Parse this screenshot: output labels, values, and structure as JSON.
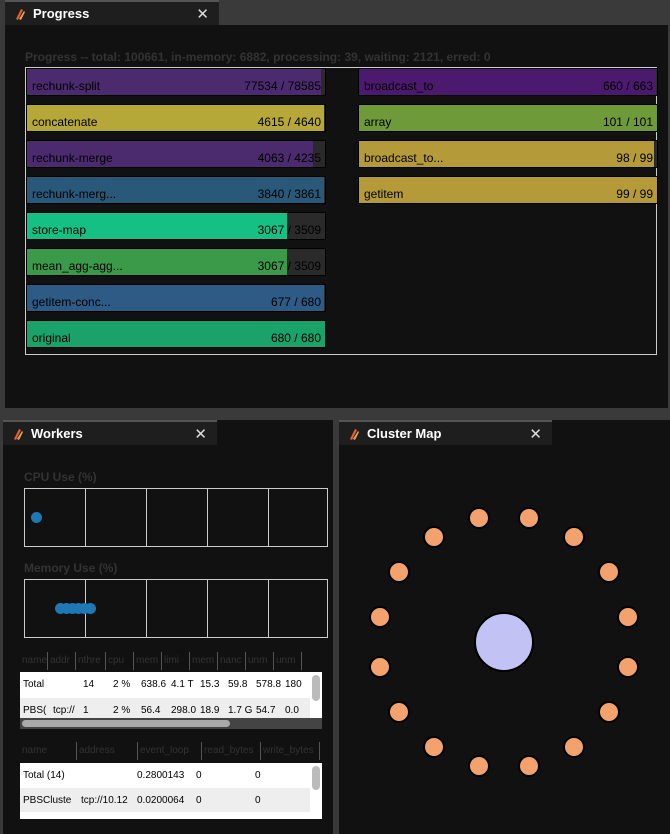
{
  "progress": {
    "tab_title": "Progress",
    "summary": "Progress -- total: 100661, in-memory: 6882, processing: 39, waiting: 2121, erred: 0",
    "left": [
      {
        "name": "rechunk-split",
        "count": "77534 / 78585",
        "fraction": 0.987,
        "color": "#4b2a6e"
      },
      {
        "name": "concatenate",
        "count": "4615 / 4640",
        "fraction": 0.995,
        "color": "#b5a839"
      },
      {
        "name": "rechunk-merge",
        "count": "4063 / 4235",
        "fraction": 0.96,
        "color": "#4b2a6e"
      },
      {
        "name": "rechunk-merg...",
        "count": "3840 / 3861",
        "fraction": 0.995,
        "color": "#2a5878"
      },
      {
        "name": "store-map",
        "count": "3067 / 3509",
        "fraction": 0.874,
        "color": "#16c084"
      },
      {
        "name": "mean_agg-agg...",
        "count": "3067 / 3509",
        "fraction": 0.874,
        "color": "#3b9a4a"
      },
      {
        "name": "getitem-conc...",
        "count": "677 / 680",
        "fraction": 0.995,
        "color": "#2e5a86"
      },
      {
        "name": "original",
        "count": "680 / 680",
        "fraction": 1.0,
        "color": "#1aa26a"
      }
    ],
    "right": [
      {
        "name": "broadcast_to",
        "count": "660 / 663",
        "fraction": 0.995,
        "color": "#4b1a6e"
      },
      {
        "name": "array",
        "count": "101 / 101",
        "fraction": 1.0,
        "color": "#6e9a3a"
      },
      {
        "name": "broadcast_to...",
        "count": "98 / 99",
        "fraction": 0.99,
        "color": "#b59a39"
      },
      {
        "name": "getitem",
        "count": "99 / 99",
        "fraction": 1.0,
        "color": "#b59a39"
      }
    ]
  },
  "workers": {
    "tab_title": "Workers",
    "cpu_title": "CPU Use (%)",
    "memory_title": "Memory Use (%)",
    "cpu_fractions": [
      0.02
    ],
    "memory_fractions": [
      0.1,
      0.12,
      0.14,
      0.16,
      0.18,
      0.2
    ],
    "table1": {
      "headers": [
        "name",
        "addr",
        "nthre",
        "cpu",
        "mem",
        "limi",
        "mem",
        "nanc",
        "unm",
        "unm"
      ],
      "rows": [
        [
          "Total",
          "14",
          "2 %",
          "638.6",
          "4.1 T",
          "15.3",
          "59.8",
          "578.8",
          "180"
        ],
        [
          "PBS(",
          "tcp://",
          "1",
          "2 %",
          "56.4",
          "298.0",
          "18.9",
          "1.7 G",
          "54.7",
          "0.0"
        ]
      ]
    },
    "table2": {
      "headers": [
        "name",
        "address",
        "event_loop",
        "read_bytes",
        "write_bytes"
      ],
      "rows": [
        [
          "Total (14)",
          "",
          "0.2800143",
          "0",
          "0"
        ],
        [
          "PBSCluste",
          "tcp://10.12",
          "0.0200064",
          "0",
          "0"
        ]
      ]
    }
  },
  "cluster": {
    "tab_title": "Cluster Map",
    "worker_count": 16,
    "worker_color": "#f4a26d",
    "scheduler_color": "#c2c2f4"
  }
}
